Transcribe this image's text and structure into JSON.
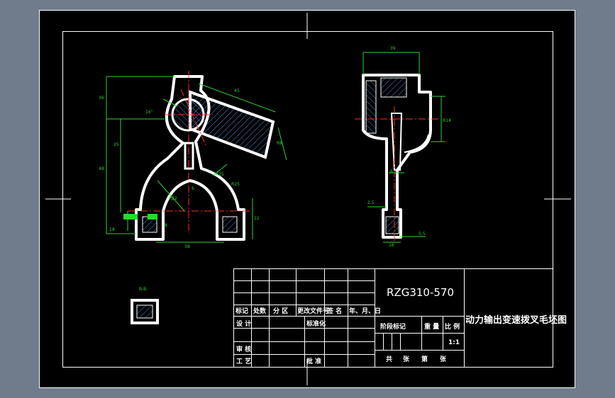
{
  "drawing": {
    "drawing_number": "RZG310-570",
    "part_title": "动力输出变速拨叉毛坯图",
    "section_label": "B-B",
    "scale_value": "1:1"
  },
  "title_block": {
    "row_labels": [
      "标记",
      "处数",
      "分 区",
      "更改文件号",
      "签 名",
      "年、月、日"
    ],
    "design": "设 计",
    "standardize": "标准化",
    "stage_label": "阶段标记",
    "weight": "重 量",
    "scale": "比 例",
    "review": "审 核",
    "process": "工 艺",
    "approve": "批 准",
    "sheets_total": "共",
    "sheet_unit": "张",
    "sheet_no": "第",
    "sheet_unit2": "张"
  },
  "dimensions": {
    "front": [
      "36",
      "45",
      "16°",
      "25",
      "48",
      "R8",
      "R25",
      "6",
      "R22",
      "R25",
      "38",
      "18",
      "8",
      "12"
    ],
    "side": [
      "39",
      "R14",
      "6",
      "2.5",
      "5.5",
      "16"
    ]
  },
  "colors": {
    "background": "#6e7c8c",
    "sheet": "#000000",
    "outline": "#ffffff",
    "dimension": "#2fd22f",
    "hatch": "#4b8fd6",
    "center_line": "#ff2d2d",
    "block": "#20e020"
  }
}
